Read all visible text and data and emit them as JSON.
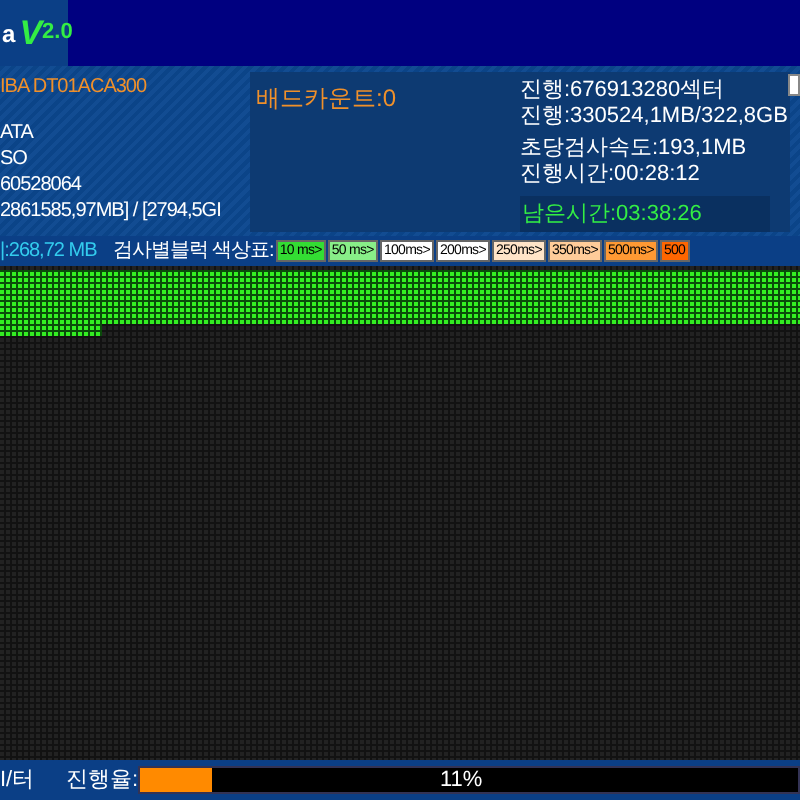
{
  "title": {
    "prefix": "a",
    "version_letter": "V",
    "version_number": "2.0"
  },
  "drive_info": [
    {
      "kind": "model",
      "text": "IBA DT01ACA300"
    },
    {
      "kind": "detail",
      "text": "ATA"
    },
    {
      "kind": "detail",
      "text": "SO"
    },
    {
      "kind": "detail",
      "text": "60528064"
    },
    {
      "kind": "detail",
      "text": "2861585,97MB] / [2794,5GI"
    }
  ],
  "bad_count": "배드카운트:0",
  "stats": [
    "진행:676913280섹터",
    "진행:330524,1MB/322,8GB",
    "초당검사속도:193,1MB",
    "진행시간:00:28:12"
  ],
  "remaining": "남은시간:03:38:26",
  "checkbox": {
    "checked": false
  },
  "buffer": "|:268,72 MB",
  "legend_label": "검사별블럭 색상표:",
  "legend": [
    {
      "label": "10 ms>",
      "color": "#33dd33"
    },
    {
      "label": "50 ms>",
      "color": "#88ee88"
    },
    {
      "label": "100ms>",
      "color": "#ffffff"
    },
    {
      "label": "200ms>",
      "color": "#ffffff"
    },
    {
      "label": "250ms>",
      "color": "#ffe4c8"
    },
    {
      "label": "350ms>",
      "color": "#ffcc99"
    },
    {
      "label": "500ms>",
      "color": "#ff9933"
    },
    {
      "label": "500",
      "color": "#ff6600"
    }
  ],
  "footer_label": "I/터",
  "progress_label": "진행율:",
  "progress": {
    "level": 0.11,
    "reading": "11%"
  }
}
